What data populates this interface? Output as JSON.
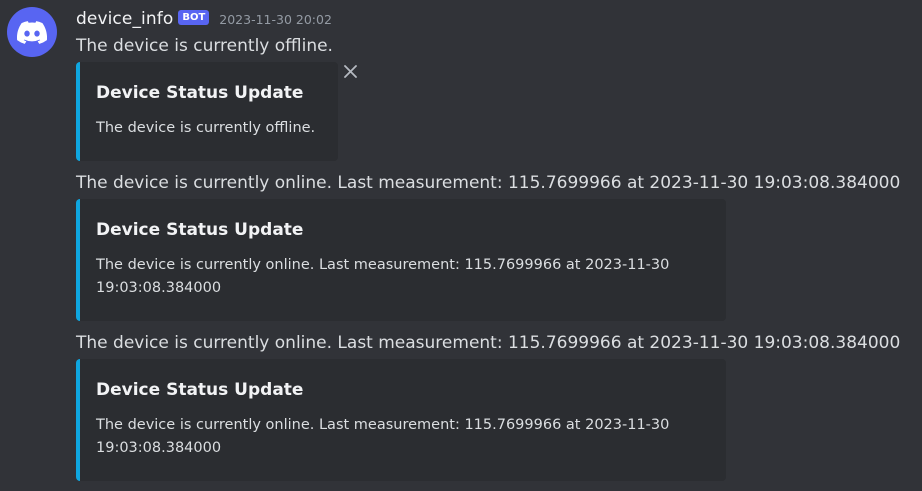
{
  "author": {
    "username": "device_info",
    "badge": "BOT",
    "timestamp": "2023-11-30 20:02",
    "avatar_icon": "discord-logo-icon",
    "avatar_color": "#5865f2"
  },
  "messages": [
    {
      "content": "The device is currently offline.",
      "embed": {
        "title": "Device Status Update",
        "description": "The device is currently offline."
      }
    },
    {
      "content": "The device is currently online. Last measurement: 115.7699966 at 2023-11-30 19:03:08.384000",
      "embed": {
        "title": "Device Status Update",
        "description_line1": "The device is currently online. Last measurement: 115.7699966 at 2023-11-30",
        "description_line2": "19:03:08.384000"
      }
    },
    {
      "content": "The device is currently online. Last measurement: 115.7699966 at 2023-11-30 19:03:08.384000",
      "embed": {
        "title": "Device Status Update",
        "description_line1": "The device is currently online. Last measurement: 115.7699966 at 2023-11-30",
        "description_line2": "19:03:08.384000"
      }
    }
  ],
  "colors": {
    "background": "#313338",
    "embed_background": "#2b2d31",
    "embed_accent": "#0fa7e0",
    "bot_badge": "#5865f2"
  },
  "icons": {
    "dismiss_embed": "close-icon"
  }
}
